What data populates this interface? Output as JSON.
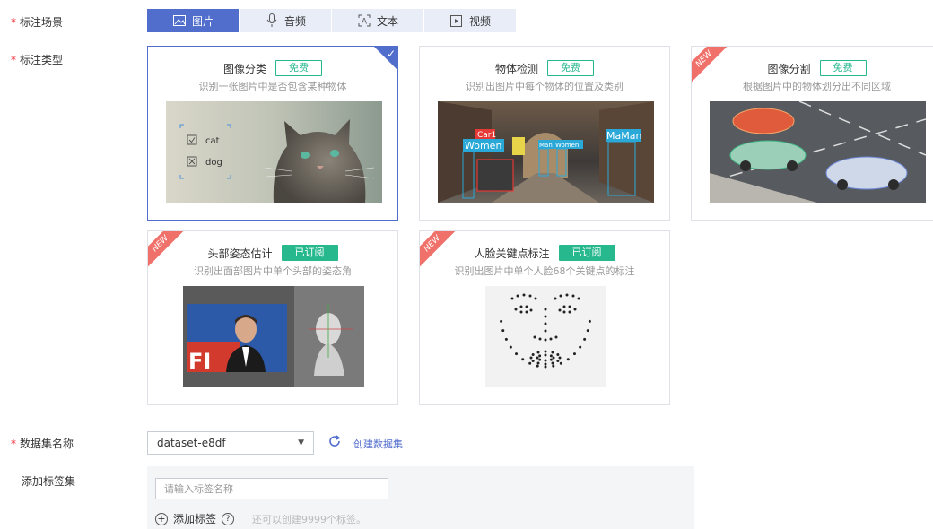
{
  "form": {
    "scene_label": "标注场景",
    "type_label": "标注类型",
    "dataset_label": "数据集名称",
    "tagset_label": "添加标签集",
    "required_mark": "*"
  },
  "scene_tabs": [
    {
      "label": "图片",
      "icon": "image-icon",
      "active": true
    },
    {
      "label": "音频",
      "icon": "microphone-icon",
      "active": false
    },
    {
      "label": "文本",
      "icon": "text-icon",
      "active": false
    },
    {
      "label": "视频",
      "icon": "video-icon",
      "active": false
    }
  ],
  "cards": [
    {
      "title": "图像分类",
      "badge": "免费",
      "badge_style": "outline",
      "desc": "识别一张图片中是否包含某种物体",
      "selected": true,
      "new": false,
      "image_labels": {
        "cat": "cat",
        "dog": "dog"
      }
    },
    {
      "title": "物体检测",
      "badge": "免费",
      "badge_style": "outline",
      "desc": "识别出图片中每个物体的位置及类别",
      "selected": false,
      "new": false,
      "image_labels": {
        "car": "Car1",
        "women1": "Women",
        "man1": "Man",
        "women2": "Women",
        "man2": "MaMan"
      }
    },
    {
      "title": "图像分割",
      "badge": "免费",
      "badge_style": "outline",
      "desc": "根据图片中的物体划分出不同区域",
      "selected": false,
      "new": true
    },
    {
      "title": "头部姿态估计",
      "badge": "已订阅",
      "badge_style": "filled",
      "desc": "识别出面部图片中单个头部的姿态角",
      "selected": false,
      "new": true
    },
    {
      "title": "人脸关键点标注",
      "badge": "已订阅",
      "badge_style": "filled",
      "desc": "识别出图片中单个人脸68个关键点的标注",
      "selected": false,
      "new": true
    }
  ],
  "ribbon_text": "NEW",
  "dataset": {
    "value": "dataset-e8df",
    "create_link": "创建数据集"
  },
  "tagset": {
    "placeholder": "请输入标签名称",
    "add_label": "添加标签",
    "hint": "还可以创建9999个标签。"
  },
  "colors": {
    "accent": "#526ecc",
    "free_badge": "#27b88e",
    "new_ribbon": "#f0716a"
  }
}
